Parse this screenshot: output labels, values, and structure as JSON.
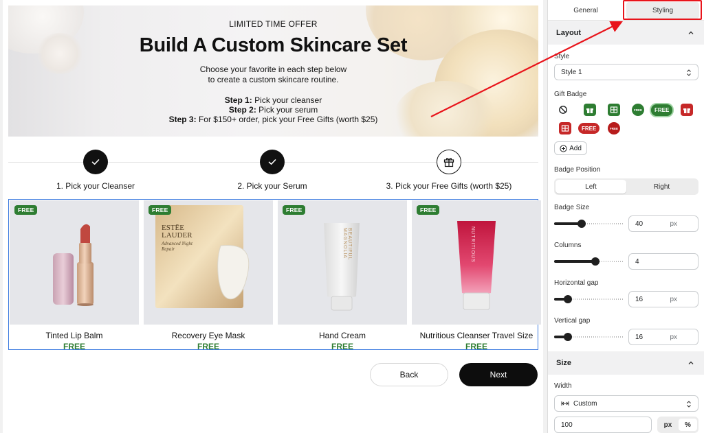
{
  "hero": {
    "eyebrow": "LIMITED TIME OFFER",
    "title": "Build A Custom Skincare Set",
    "desc_line1": "Choose your favorite in each step below",
    "desc_line2": "to create a custom skincare routine.",
    "steps": [
      {
        "label": "Step 1:",
        "text": " Pick your cleanser"
      },
      {
        "label": "Step 2:",
        "text": " Pick your serum"
      },
      {
        "label": "Step 3:",
        "text": " For $150+ order, pick your Free Gifts (worth $25)"
      }
    ]
  },
  "progress": {
    "steps": [
      {
        "label": "1. Pick your Cleanser",
        "state": "done",
        "icon": "check-icon"
      },
      {
        "label": "2. Pick your Serum",
        "state": "done",
        "icon": "check-icon"
      },
      {
        "label": "3. Pick your Free Gifts (worth $25)",
        "state": "current",
        "icon": "gift-icon"
      }
    ]
  },
  "products": [
    {
      "badge": "FREE",
      "name": "Tinted Lip Balm",
      "price": "FREE",
      "image": "lip-balm-image"
    },
    {
      "badge": "FREE",
      "name": "Recovery Eye Mask",
      "price": "FREE",
      "image": "eye-mask-image"
    },
    {
      "badge": "FREE",
      "name": "Hand Cream",
      "price": "FREE",
      "image": "hand-cream-image"
    },
    {
      "badge": "FREE",
      "name": "Nutritious Cleanser Travel Size",
      "price": "FREE",
      "image": "cleanser-tube-image"
    }
  ],
  "product_art": {
    "eye_mask_brand": "ESTĒE LAUDER",
    "eye_mask_sub": "Advanced Night Repair",
    "hand_cream_brand": "BEAUTIFUL MAGNOLIA",
    "cleanser_brand": "NUTRITIOUS"
  },
  "nav": {
    "back": "Back",
    "next": "Next"
  },
  "panel": {
    "tabs": {
      "general": "General",
      "styling": "Styling"
    },
    "layout": {
      "title": "Layout",
      "style_label": "Style",
      "style_value": "Style 1",
      "gift_badge_label": "Gift Badge",
      "gift_badges": [
        "none-icon",
        "gift-box-green-icon",
        "gift-box-green-2-icon",
        "free-seal-green-icon",
        "free-pill-green-icon",
        "gift-box-red-icon",
        "gift-box-red-2-icon",
        "free-pill-red-icon",
        "free-seal-red-icon"
      ],
      "badge_text": "FREE",
      "add_label": "Add",
      "badge_position_label": "Badge Position",
      "badge_position_options": [
        "Left",
        "Right"
      ],
      "badge_position_selected": "Left",
      "badge_size_label": "Badge Size",
      "badge_size_value": "40",
      "badge_size_level": 0.4,
      "badge_size_unit": "px",
      "columns_label": "Columns",
      "columns_value": "4",
      "columns_level": 0.6,
      "hgap_label": "Horizontal gap",
      "hgap_value": "16",
      "hgap_level": 0.2,
      "hgap_unit": "px",
      "vgap_label": "Vertical gap",
      "vgap_value": "16",
      "vgap_level": 0.2,
      "vgap_unit": "px"
    },
    "size": {
      "title": "Size",
      "width_label": "Width",
      "width_mode": "Custom",
      "width_value": "100",
      "units": [
        "px",
        "%"
      ],
      "unit_selected": "%"
    }
  },
  "colors": {
    "highlight": "#e8141b",
    "free_green": "#2e7d32",
    "selection_border": "#3d7be0"
  }
}
